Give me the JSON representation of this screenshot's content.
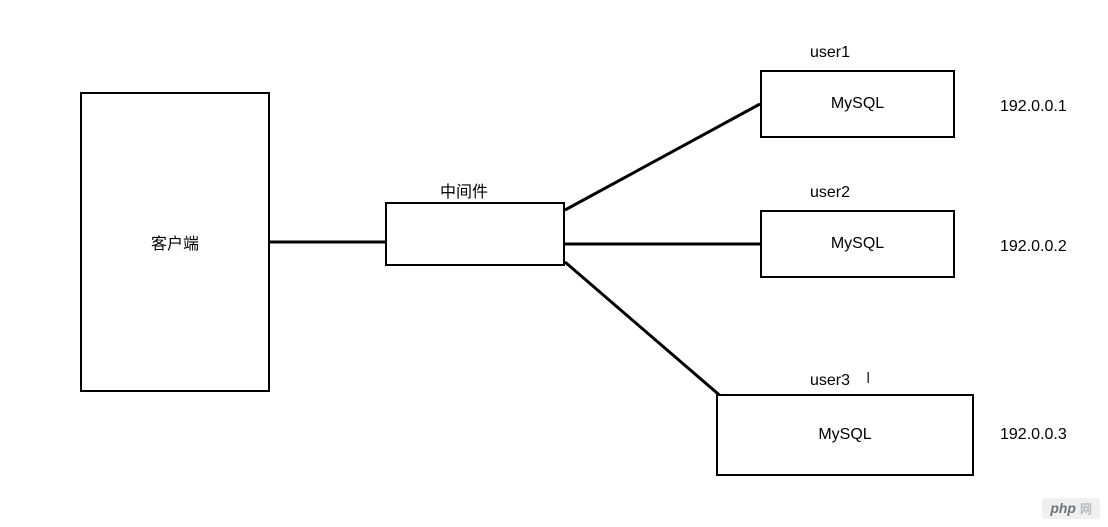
{
  "diagram": {
    "client": {
      "label": "客户端"
    },
    "middleware": {
      "label": "中间件"
    },
    "nodes": [
      {
        "user": "user1",
        "db": "MySQL",
        "ip": "192.0.0.1"
      },
      {
        "user": "user2",
        "db": "MySQL",
        "ip": "192.0.0.2"
      },
      {
        "user": "user3",
        "db": "MySQL",
        "ip": "192.0.0.3"
      }
    ]
  },
  "watermark": {
    "brand": "php",
    "suffix": "网"
  }
}
